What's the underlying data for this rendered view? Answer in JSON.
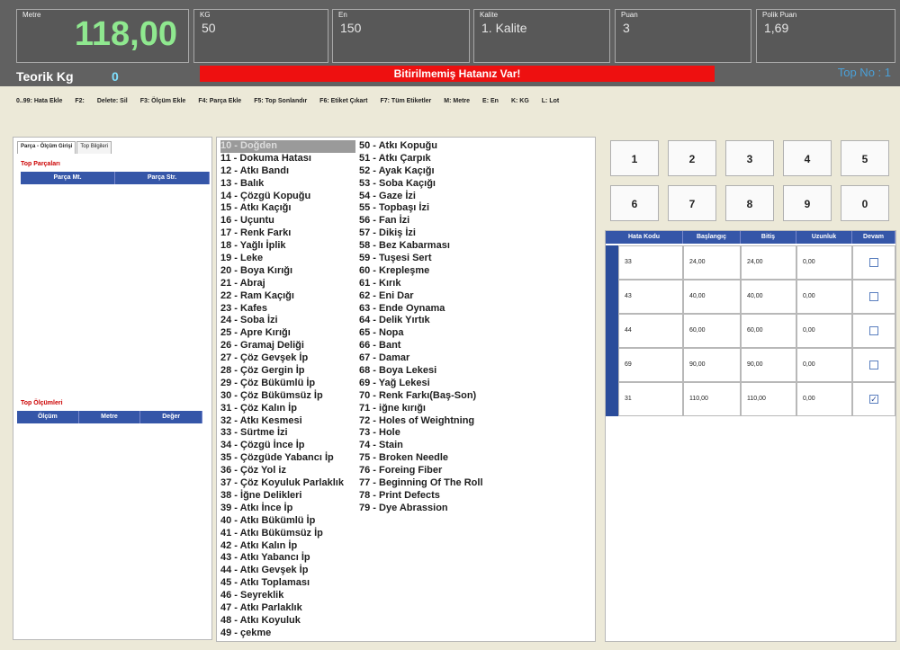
{
  "top": {
    "meter": {
      "label": "Metre",
      "value": "118,00"
    },
    "kg": {
      "label": "KG",
      "value": "50"
    },
    "en": {
      "label": "En",
      "value": "150"
    },
    "kalite": {
      "label": "Kalite",
      "value": "1. Kalite"
    },
    "puan": {
      "label": "Puan",
      "value": "3"
    },
    "polik_puan": {
      "label": "Polik Puan",
      "value": "1,69"
    },
    "teorik_label": "Teorik Kg",
    "teorik_value": "0",
    "error_banner": "Bitirilmemiş Hatanız Var!",
    "top_no": "Top No : 1"
  },
  "fkeys": [
    "0..99: Hata Ekle",
    "F2:",
    "Delete: Sil",
    "F3: Ölçüm Ekle",
    "F4: Parça Ekle",
    "F5: Top Sonlandır",
    "F6: Etiket Çıkart",
    "F7: Tüm Etiketler",
    "M: Metre",
    "E: En",
    "K: KG",
    "L: Lot"
  ],
  "left": {
    "tabs": [
      "Parça - Ölçüm Girişi",
      "Top Bilgileri"
    ],
    "parts_title": "Top Parçaları",
    "parts_headers": [
      "Parça Mt.",
      "Parça Str."
    ],
    "measure_title": "Top Ölçümleri",
    "measure_headers": [
      "Ölçüm",
      "Metre",
      "Değer"
    ]
  },
  "codes_col1": [
    "10 - Doğden",
    "11 - Dokuma Hatası",
    "12 - Atkı Bandı",
    "13 - Balık",
    "14 - Çözgü Kopuğu",
    "15 - Atkı Kaçığı",
    "16 - Uçuntu",
    "17 - Renk Farkı",
    "18 - Yağlı İplik",
    "19 - Leke",
    "20 - Boya Kırığı",
    "21 - Abraj",
    "22 - Ram Kaçığı",
    "23 - Kafes",
    "24 - Soba İzi",
    "25 - Apre Kırığı",
    "26 - Gramaj Deliği",
    "27 - Çöz Gevşek İp",
    "28 - Çöz Gergin İp",
    "29 - Çöz Bükümlü İp",
    "30 - Çöz Bükümsüz İp",
    "31 - Çöz Kalın İp",
    "32 - Atkı Kesmesi",
    "33 - Sürtme İzi",
    "34 - Çözgü İnce İp",
    "35 - Çözgüde Yabancı İp",
    "36 - Çöz Yol iz",
    "37 - Çöz Koyuluk Parlaklık",
    "38 - İğne Delikleri",
    "39 - Atkı İnce İp",
    "40 - Atkı Bükümlü İp",
    "41 - Atkı Bükümsüz İp",
    "42 - Atkı Kalın İp",
    "43 - Atkı Yabancı İp",
    "44 - Atkı Gevşek İp",
    "45 - Atkı Toplaması",
    "46 - Seyreklik",
    "47 - Atkı Parlaklık",
    "48 - Atkı Koyuluk",
    "49 - çekme"
  ],
  "codes_col2": [
    "50 - Atkı Kopuğu",
    "51 - Atkı Çarpık",
    "52 - Ayak Kaçığı",
    "53 - Soba Kaçığı",
    "54 - Gaze İzi",
    "55 - Topbaşı İzi",
    "56 - Fan İzi",
    "57 - Dikiş İzi",
    "58 - Bez Kabarması",
    "59 - Tuşesi Sert",
    "60 - Krepleşme",
    "61 - Kırık",
    "62 - Eni Dar",
    "63 - Ende Oynama",
    "64 - Delik Yırtık",
    "65 - Nopa",
    "66 - Bant",
    "67 - Damar",
    "68 - Boya Lekesi",
    "69 - Yağ Lekesi",
    "70 - Renk Farkı(Baş-Son)",
    "71 - iğne kırığı",
    "72 - Holes of Weightning",
    "73 - Hole",
    "74 - Stain",
    "75 - Broken Needle",
    "76 - Foreing Fiber",
    "77 - Beginning Of The Roll",
    "78 - Print Defects",
    "79 - Dye Abrassion"
  ],
  "keypad": [
    "1",
    "2",
    "3",
    "4",
    "5",
    "6",
    "7",
    "8",
    "9",
    "0"
  ],
  "error_grid": {
    "headers": [
      "Hata Kodu",
      "Başlangıç",
      "Bitiş",
      "Uzunluk",
      "Devam"
    ],
    "rows": [
      {
        "code": "33",
        "start": "24,00",
        "end": "24,00",
        "length": "0,00",
        "cont": false
      },
      {
        "code": "43",
        "start": "40,00",
        "end": "40,00",
        "length": "0,00",
        "cont": false
      },
      {
        "code": "44",
        "start": "60,00",
        "end": "60,00",
        "length": "0,00",
        "cont": false
      },
      {
        "code": "69",
        "start": "90,00",
        "end": "90,00",
        "length": "0,00",
        "cont": false
      },
      {
        "code": "31",
        "start": "110,00",
        "end": "110,00",
        "length": "0,00",
        "cont": true
      }
    ]
  }
}
